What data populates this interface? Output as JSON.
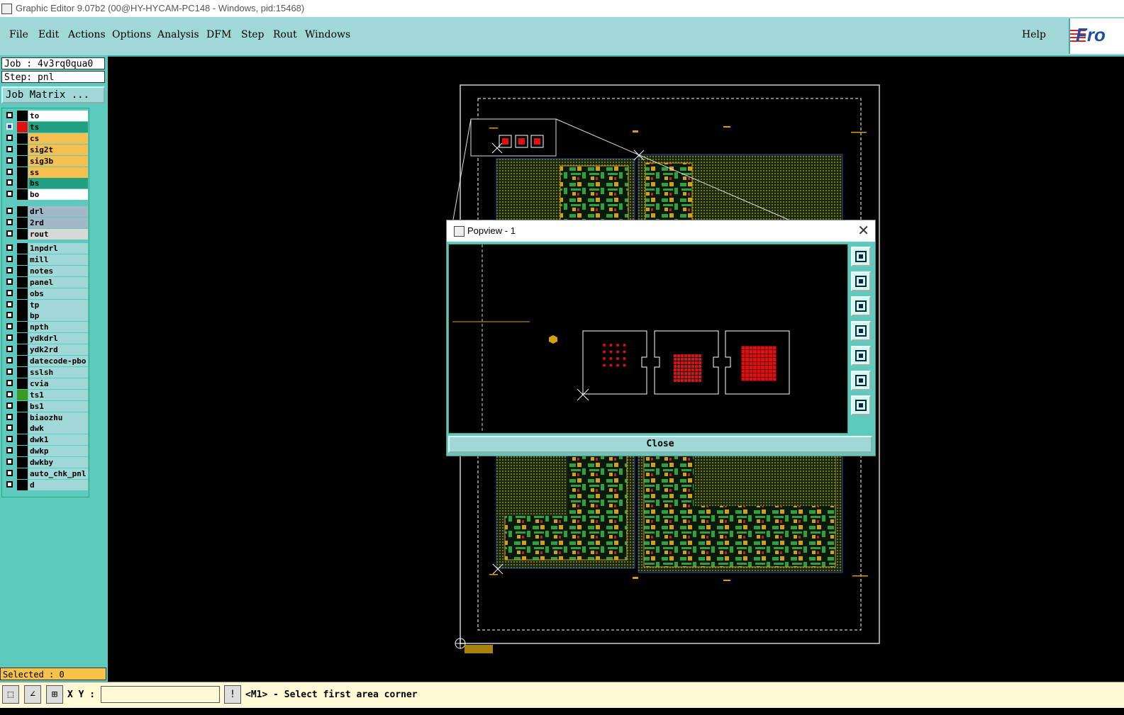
{
  "window": {
    "title": "Graphic Editor 9.07b2 (00@HY-HYCAM-PC148 - Windows, pid:15468)"
  },
  "menu": {
    "items": [
      "File",
      "Edit",
      "Actions",
      "Options",
      "Analysis",
      "DFM",
      "Step",
      "Rout",
      "Windows"
    ],
    "help": "Help",
    "logo_text": "Fro"
  },
  "left_panel": {
    "job": "Job : 4v3rq0qua0",
    "step": "Step: pnl",
    "job_matrix": "Job Matrix ...",
    "layers_board": [
      {
        "name": "to",
        "color": "#ffffff",
        "swatch": "#000000",
        "checked": false
      },
      {
        "name": "ts",
        "color": "#20a080",
        "swatch": "#e01010",
        "checked": true
      },
      {
        "name": "cs",
        "color": "#f5c050",
        "swatch": "#000000",
        "checked": false
      },
      {
        "name": "sig2t",
        "color": "#f5c050",
        "swatch": "#000000",
        "checked": false
      },
      {
        "name": "sig3b",
        "color": "#f5c050",
        "swatch": "#000000",
        "checked": false
      },
      {
        "name": "ss",
        "color": "#f5c050",
        "swatch": "#000000",
        "checked": false
      },
      {
        "name": "bs",
        "color": "#20a080",
        "swatch": "#000000",
        "checked": false
      },
      {
        "name": "bo",
        "color": "#ffffff",
        "swatch": "#000000",
        "checked": false
      }
    ],
    "layers_drill": [
      {
        "name": "drl",
        "color": "#a0b8c8",
        "swatch": "#000000",
        "checked": false
      },
      {
        "name": "2rd",
        "color": "#a0b8c8",
        "swatch": "#000000",
        "checked": false
      },
      {
        "name": "rout",
        "color": "#d8d8d8",
        "swatch": "#000000",
        "checked": false
      }
    ],
    "layers_misc": [
      {
        "name": "1npdrl",
        "color": "#9fd8d6",
        "swatch": "#000000",
        "checked": false
      },
      {
        "name": "mill",
        "color": "#9fd8d6",
        "swatch": "#000000",
        "checked": false
      },
      {
        "name": "notes",
        "color": "#9fd8d6",
        "swatch": "#000000",
        "checked": false
      },
      {
        "name": "panel",
        "color": "#9fd8d6",
        "swatch": "#000000",
        "checked": false
      },
      {
        "name": "obs",
        "color": "#9fd8d6",
        "swatch": "#000000",
        "checked": false
      },
      {
        "name": "tp",
        "color": "#9fd8d6",
        "swatch": "#000000",
        "checked": false
      },
      {
        "name": "bp",
        "color": "#9fd8d6",
        "swatch": "#000000",
        "checked": false
      },
      {
        "name": "npth",
        "color": "#9fd8d6",
        "swatch": "#000000",
        "checked": false
      },
      {
        "name": "ydkdrl",
        "color": "#9fd8d6",
        "swatch": "#000000",
        "checked": false
      },
      {
        "name": "ydk2rd",
        "color": "#9fd8d6",
        "swatch": "#000000",
        "checked": false
      },
      {
        "name": "datecode-pbo",
        "color": "#9fd8d6",
        "swatch": "#000000",
        "checked": false
      },
      {
        "name": "sslsh",
        "color": "#9fd8d6",
        "swatch": "#000000",
        "checked": false
      },
      {
        "name": "cvia",
        "color": "#9fd8d6",
        "swatch": "#000000",
        "checked": false
      },
      {
        "name": "ts1",
        "color": "#9fd8d6",
        "swatch": "#3a9a20",
        "checked": false
      },
      {
        "name": "bs1",
        "color": "#9fd8d6",
        "swatch": "#000000",
        "checked": false
      },
      {
        "name": "biaozhu",
        "color": "#9fd8d6",
        "swatch": "#000000",
        "checked": false
      },
      {
        "name": "dwk",
        "color": "#9fd8d6",
        "swatch": "#000000",
        "checked": false
      },
      {
        "name": "dwk1",
        "color": "#9fd8d6",
        "swatch": "#000000",
        "checked": false
      },
      {
        "name": "dwkp",
        "color": "#9fd8d6",
        "swatch": "#000000",
        "checked": false
      },
      {
        "name": "dwkby",
        "color": "#9fd8d6",
        "swatch": "#000000",
        "checked": false
      },
      {
        "name": "auto_chk_pnl",
        "color": "#9fd8d6",
        "swatch": "#000000",
        "checked": false
      },
      {
        "name": "d",
        "color": "#9fd8d6",
        "swatch": "#000000",
        "checked": false
      }
    ],
    "selected": "Selected : 0"
  },
  "status": {
    "xy_label": "X Y :",
    "xy_value": "",
    "prompt": "<M1> - Select first area corner"
  },
  "popview": {
    "title": "Popview - 1",
    "close_label": "Close",
    "tools": [
      "zoom-window-icon",
      "pan-up-icon",
      "pan-down-icon",
      "pan-left-icon",
      "pan-right-icon",
      "zoom-fit-icon",
      "center-icon"
    ]
  }
}
